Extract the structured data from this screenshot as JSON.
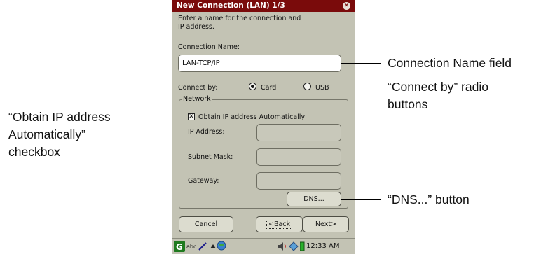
{
  "dialog": {
    "title": "New Connection (LAN) 1/3",
    "close_glyph": "×",
    "intro_line1": "Enter a name for the connection and",
    "intro_line2": "IP address.",
    "connection_name_label": "Connection Name:",
    "connection_name_value": "LAN-TCP/IP",
    "connect_by_label": "Connect by:",
    "connect_by_options": [
      "Card",
      "USB"
    ],
    "connect_by_selected": "Card",
    "network_group_label": "Network",
    "obtain_ip_label": "Obtain IP address Automatically",
    "obtain_ip_checked": true,
    "check_glyph": "✕",
    "ip_address_label": "IP Address:",
    "subnet_mask_label": "Subnet Mask:",
    "gateway_label": "Gateway:",
    "dns_button": "DNS...",
    "cancel_button": "Cancel",
    "back_button": "<Back",
    "next_button": "Next>"
  },
  "taskbar": {
    "input_mode": "abc",
    "clock": "12:33 AM"
  },
  "callouts": {
    "connection_name": "Connection Name field",
    "connect_by_line1": "“Connect by” radio",
    "connect_by_line2": "buttons",
    "obtain_ip_line1": "“Obtain IP address",
    "obtain_ip_line2": "Automatically”",
    "obtain_ip_line3": "checkbox",
    "dns": "“DNS...” button"
  },
  "colors": {
    "title_bar": "#7a0b0b",
    "dialog_bg": "#c3c3b4",
    "field_bg": "#ffffff"
  }
}
